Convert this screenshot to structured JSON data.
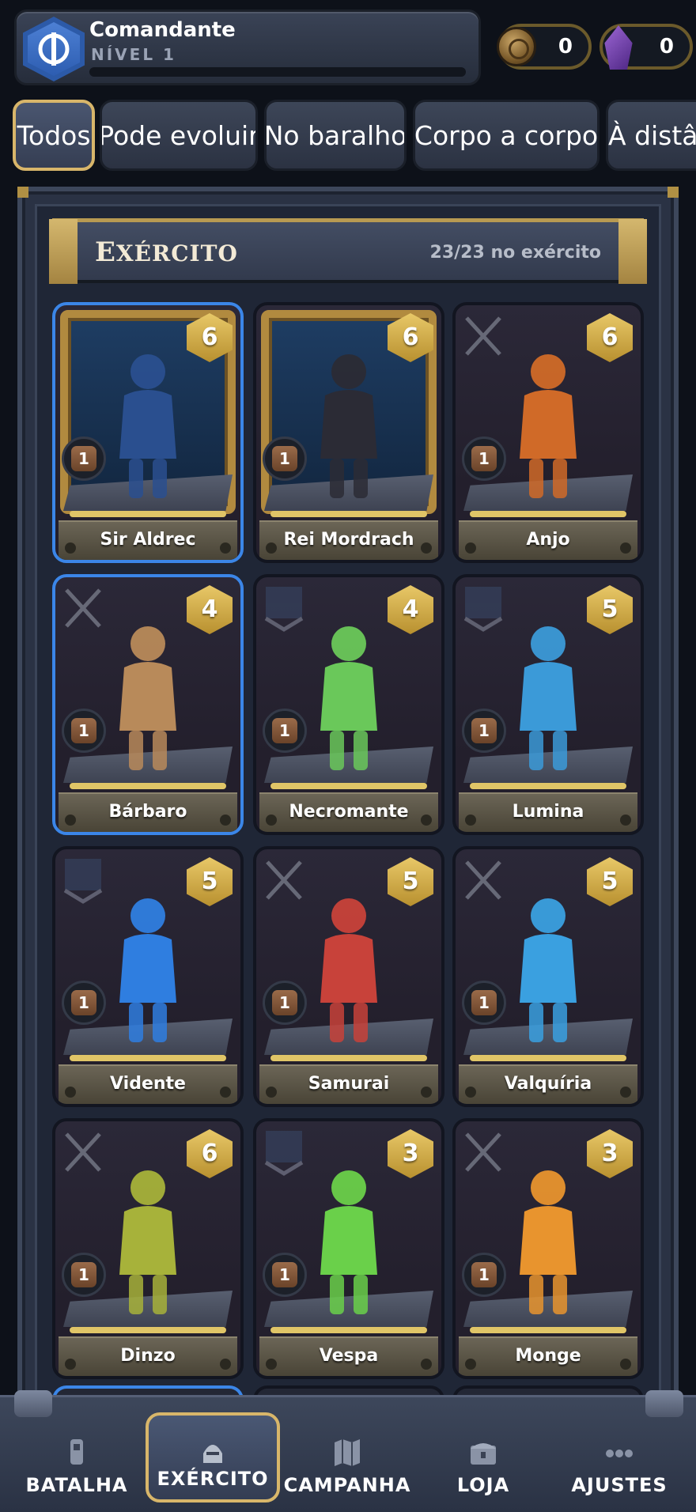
{
  "profile": {
    "name": "Comandante",
    "level": "NÍVEL 1",
    "xp_fraction": 0.0
  },
  "currencies": [
    {
      "icon": "gold-coin-icon",
      "value": "0"
    },
    {
      "icon": "purple-crystal-icon",
      "value": "0"
    }
  ],
  "filters": {
    "active": "Todos",
    "tabs": [
      "Todos",
      "Pode evoluir",
      "No baralho",
      "Corpo a corpo",
      "À distâ"
    ]
  },
  "army": {
    "title": "Exército",
    "count": "23/23 no exército"
  },
  "units": [
    {
      "name": "Sir Aldrec",
      "cost": "6",
      "level": "1",
      "selected": true,
      "framed": true,
      "color": "#2a4f8f"
    },
    {
      "name": "Rei Mordrach",
      "cost": "6",
      "level": "1",
      "selected": false,
      "framed": true,
      "color": "#2b2b35"
    },
    {
      "name": "Anjo",
      "cost": "6",
      "level": "1",
      "selected": false,
      "framed": false,
      "crest": "swords-crest-icon",
      "color": "#d06a28"
    },
    {
      "name": "Bárbaro",
      "cost": "4",
      "level": "1",
      "selected": true,
      "framed": false,
      "crest": "swords-crest-icon",
      "color": "#b88a5a"
    },
    {
      "name": "Necromante",
      "cost": "4",
      "level": "1",
      "selected": false,
      "framed": false,
      "crest": "banner-crest-icon",
      "color": "#6ac85a"
    },
    {
      "name": "Lumina",
      "cost": "5",
      "level": "1",
      "selected": false,
      "framed": false,
      "crest": "banner-crest-icon",
      "color": "#3b9ad8"
    },
    {
      "name": "Vidente",
      "cost": "5",
      "level": "1",
      "selected": false,
      "framed": false,
      "crest": "banner-crest-icon",
      "color": "#2f7ee0"
    },
    {
      "name": "Samurai",
      "cost": "5",
      "level": "1",
      "selected": false,
      "framed": false,
      "crest": "swords-crest-icon",
      "color": "#c8423a"
    },
    {
      "name": "Valquíria",
      "cost": "5",
      "level": "1",
      "selected": false,
      "framed": false,
      "crest": "swords-crest-icon",
      "color": "#3aa0e0"
    },
    {
      "name": "Dinzo",
      "cost": "6",
      "level": "1",
      "selected": false,
      "framed": false,
      "crest": "swords-crest-icon",
      "color": "#a7b23a"
    },
    {
      "name": "Vespa",
      "cost": "3",
      "level": "1",
      "selected": false,
      "framed": false,
      "crest": "banner-crest-icon",
      "color": "#6ad04a"
    },
    {
      "name": "Monge",
      "cost": "3",
      "level": "1",
      "selected": false,
      "framed": false,
      "crest": "swords-crest-icon",
      "color": "#e8942e"
    }
  ],
  "nav": {
    "active": "Exército",
    "items": [
      {
        "label": "BATALHA",
        "icon": "battle-icon"
      },
      {
        "label": "EXÉRCITO",
        "icon": "helmet-icon"
      },
      {
        "label": "CAMPANHA",
        "icon": "map-icon"
      },
      {
        "label": "LOJA",
        "icon": "chest-icon"
      },
      {
        "label": "AJUSTES",
        "icon": "settings-dots-icon"
      }
    ]
  },
  "colors": {
    "accent_gold": "#d8b66a",
    "selected_blue": "#3b86e8",
    "background": "#0d1119"
  }
}
